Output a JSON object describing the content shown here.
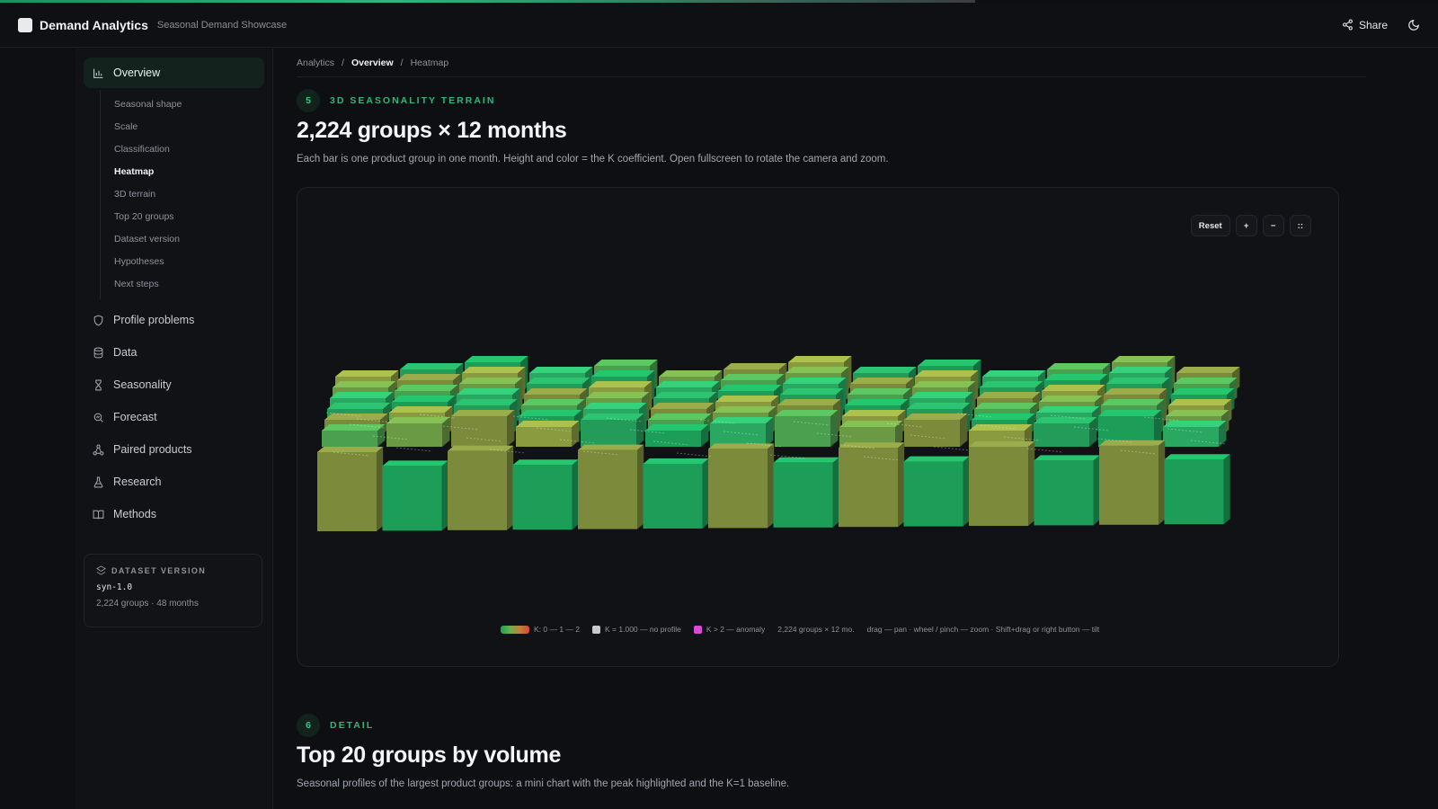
{
  "colors": {
    "accent": "#2fb67a",
    "no_profile": "#c8c9cc",
    "anomaly": "#d94ad8",
    "bar_green": "#1d9e58",
    "bar_olive": "#7c8a3c"
  },
  "header": {
    "app_title": "Demand Analytics",
    "app_subtitle": "Seasonal Demand Showcase",
    "share_label": "Share",
    "theme_icon": "moon-icon"
  },
  "sidebar": {
    "overview": {
      "label": "Overview",
      "icon": "bar-chart-icon"
    },
    "sub_items": [
      "Seasonal shape",
      "Scale",
      "Classification",
      "Heatmap",
      "3D terrain",
      "Top 20 groups",
      "Dataset version",
      "Hypotheses",
      "Next steps"
    ],
    "active_sub": "Heatmap",
    "items": [
      {
        "label": "Profile problems",
        "icon": "shield-icon"
      },
      {
        "label": "Data",
        "icon": "database-icon"
      },
      {
        "label": "Seasonality",
        "icon": "hourglass-icon"
      },
      {
        "label": "Forecast",
        "icon": "search-chart-icon"
      },
      {
        "label": "Paired products",
        "icon": "network-icon"
      },
      {
        "label": "Research",
        "icon": "flask-icon"
      },
      {
        "label": "Methods",
        "icon": "book-icon"
      }
    ],
    "dataset_card": {
      "title": "DATASET VERSION",
      "version": "syn-1.0",
      "meta": "2,224 groups · 48 months"
    }
  },
  "breadcrumb": [
    "Analytics",
    "Overview",
    "Heatmap"
  ],
  "section5": {
    "number": "5",
    "eyebrow": "3D SEASONALITY TERRAIN",
    "title": "2,224 groups × 12 months",
    "lede": "Each bar is one product group in one month. Height and color = the K coefficient. Open fullscreen to rotate the camera and zoom.",
    "controls": {
      "reset": "Reset",
      "zoom_in": "+",
      "zoom_out": "−",
      "fullscreen": "::"
    },
    "legend": {
      "k_scale": "K: 0 — 1 — 2",
      "no_profile": "K = 1.000 — no profile",
      "anomaly": "K > 2 — anomaly",
      "dims": "2,224 groups × 12 mo.",
      "help": "drag — pan · wheel / pinch — zoom · Shift+drag or right button — tilt"
    }
  },
  "section6": {
    "number": "6",
    "eyebrow": "DETAIL",
    "title": "Top 20 groups by volume",
    "lede": "Seasonal profiles of the largest product groups: a mini chart with the peak highlighted and the K=1 baseline."
  }
}
